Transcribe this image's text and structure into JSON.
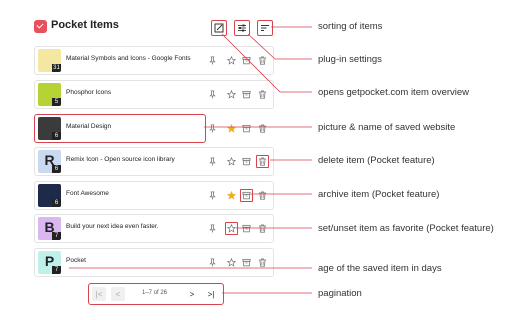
{
  "header": {
    "title": "Pocket Items"
  },
  "items": [
    {
      "title": "Material Symbols and Icons - Google Fonts",
      "age": "31",
      "favorite": false,
      "thumb_letter": "",
      "thumb_bg": "#f4e7a1"
    },
    {
      "title": "Phosphor Icons",
      "age": "5",
      "favorite": false,
      "thumb_letter": "",
      "thumb_bg": "#b5d334"
    },
    {
      "title": "Material Design",
      "age": "6",
      "favorite": true,
      "thumb_letter": "",
      "thumb_bg": "#3b3b3b"
    },
    {
      "title": "Remix Icon - Open source icon library",
      "age": "6",
      "favorite": false,
      "thumb_letter": "R",
      "thumb_bg": "#c9d9f0"
    },
    {
      "title": "Font Awesome",
      "age": "6",
      "favorite": true,
      "thumb_letter": "",
      "thumb_bg": "#1d2a4a"
    },
    {
      "title": "Build your next idea even faster.",
      "age": "7",
      "favorite": false,
      "thumb_letter": "B",
      "thumb_bg": "#d9b8f2"
    },
    {
      "title": "Pocket",
      "age": "7",
      "favorite": false,
      "thumb_letter": "P",
      "thumb_bg": "#bff0ea"
    }
  ],
  "pagination": {
    "text": "1–7 of 26",
    "first": "|<",
    "prev": "<",
    "next": ">",
    "last": ">|"
  },
  "callouts": {
    "sorting": "sorting of items",
    "settings": "plug-in settings",
    "overview": "opens getpocket.com item overview",
    "picture": "picture & name of saved website",
    "delete": "delete item (Pocket feature)",
    "archive": "archive item (Pocket feature)",
    "favorite": "set/unset item as favorite (Pocket feature)",
    "age": "age of the saved item in days",
    "pagination": "pagination"
  },
  "colors": {
    "accent": "#d9434e",
    "favorite_star": "#f2b01e",
    "icon_gray": "#777777"
  }
}
